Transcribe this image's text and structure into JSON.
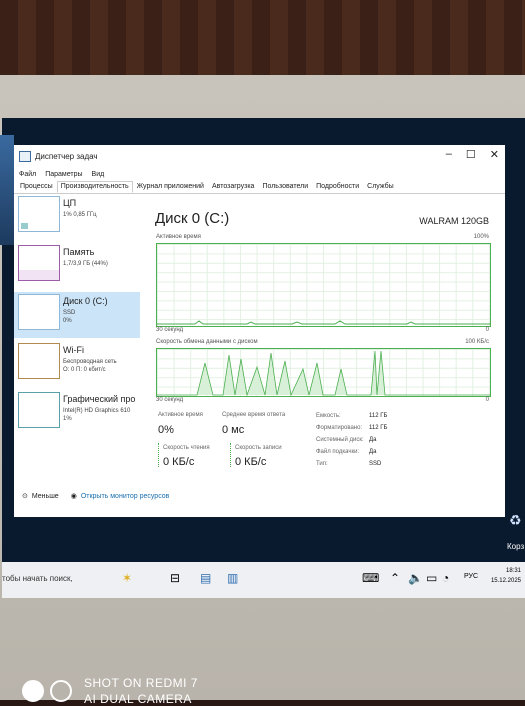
{
  "window": {
    "title": "Диспетчер задач",
    "controls": [
      "–",
      "☐",
      "✕"
    ]
  },
  "menu": [
    "Файл",
    "Параметры",
    "Вид"
  ],
  "tabs": [
    "Процессы",
    "Производительность",
    "Журнал приложений",
    "Автозагрузка",
    "Пользователи",
    "Подробности",
    "Службы"
  ],
  "active_tab": "Производительность",
  "sidebar": [
    {
      "name": "ЦП",
      "sub1": "1% 0,85 ГГц",
      "sub2": ""
    },
    {
      "name": "Память",
      "sub1": "1,7/3,9 ГБ (44%)",
      "sub2": ""
    },
    {
      "name": "Диск 0 (C:)",
      "sub1": "SSD",
      "sub2": "0%"
    },
    {
      "name": "Wi-Fi",
      "sub1": "Беспроводная сеть",
      "sub2": "О: 0 П: 0 кбит/с"
    },
    {
      "name": "Графический про",
      "sub1": "Intel(R) HD Graphics 610",
      "sub2": "1%"
    }
  ],
  "main": {
    "title": "Диск 0 (C:)",
    "model": "WALRAM 120GB",
    "graph1": {
      "label": "Активное время",
      "max": "100%",
      "time": "30 секунд",
      "min": "0"
    },
    "graph2": {
      "label": "Скорость обмена данными с диском",
      "max": "100 КБ/с",
      "time": "30 секунд",
      "min": "0"
    }
  },
  "stats": {
    "active_label": "Активное время",
    "active_value": "0%",
    "resp_label": "Среднее время ответа",
    "resp_value": "0 мс",
    "read_label": "Скорость чтения",
    "read_value": "0 КБ/с",
    "write_label": "Скорость записи",
    "write_value": "0 КБ/с",
    "props": [
      {
        "k": "Емкость:",
        "v": "112 ГБ"
      },
      {
        "k": "Форматировано:",
        "v": "112 ГБ"
      },
      {
        "k": "Системный диск:",
        "v": "Да"
      },
      {
        "k": "Файл подкачки:",
        "v": "Да"
      },
      {
        "k": "Тип:",
        "v": "SSD"
      }
    ]
  },
  "footer": {
    "less": "Меньше",
    "monitor": "Открыть монитор ресурсов"
  },
  "taskbar": {
    "search": "тобы начать поиск,",
    "lang": "РУС",
    "time": "18:31",
    "date": "15.12.2025"
  },
  "desktop": {
    "recycle_label": "Корз"
  },
  "watermark": {
    "line1": "SHOT ON REDMI 7",
    "line2": "AI DUAL CAMERA"
  },
  "colors": {
    "accent": "#4caf50",
    "selection": "#cce4f7"
  }
}
